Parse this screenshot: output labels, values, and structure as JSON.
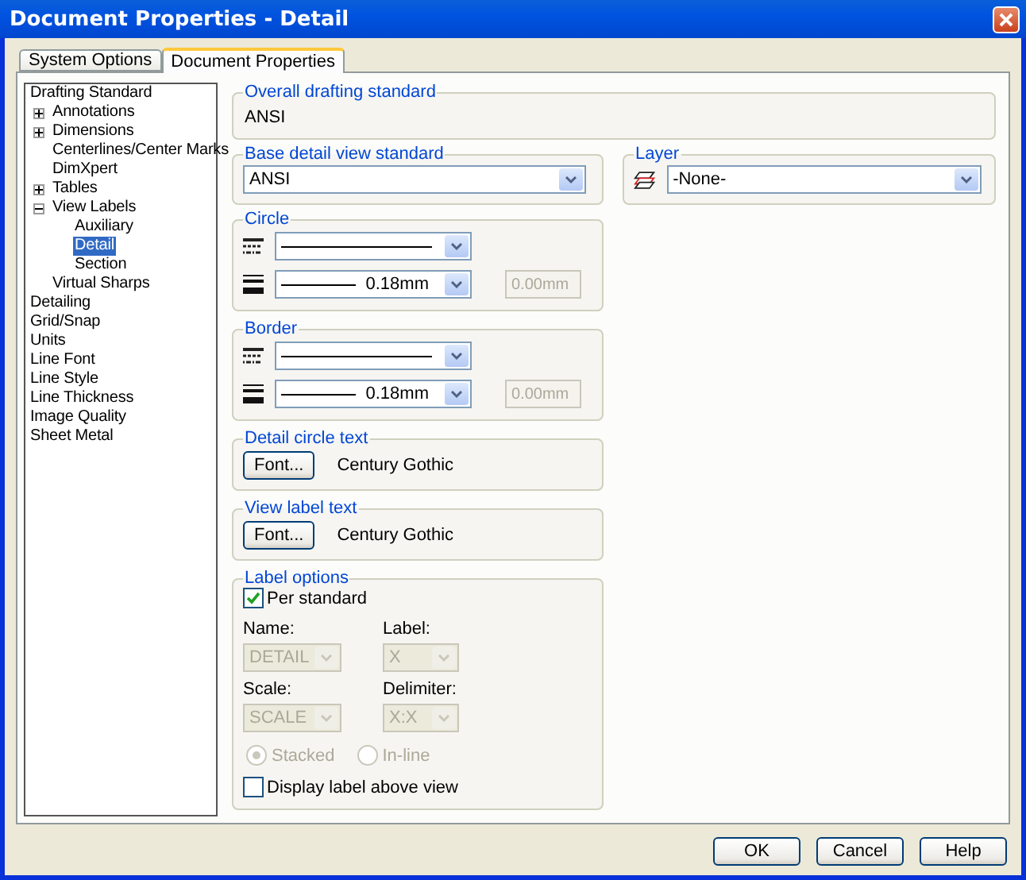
{
  "window": {
    "title": "Document Properties - Detail"
  },
  "tabs": [
    {
      "label": "System Options",
      "selected": false
    },
    {
      "label": "Document Properties",
      "selected": true
    }
  ],
  "tree": [
    {
      "label": "Drafting Standard",
      "selected": false,
      "children": [
        {
          "label": "Annotations",
          "selected": false,
          "expanded": false
        },
        {
          "label": "Dimensions",
          "selected": false,
          "expanded": false
        },
        {
          "label": "Centerlines/Center Marks",
          "selected": false
        },
        {
          "label": "DimXpert",
          "selected": false
        },
        {
          "label": "Tables",
          "selected": false,
          "expanded": false
        },
        {
          "label": "View Labels",
          "selected": false,
          "expanded": true,
          "children": [
            {
              "label": "Auxiliary",
              "selected": false
            },
            {
              "label": "Detail",
              "selected": true
            },
            {
              "label": "Section",
              "selected": false
            }
          ]
        },
        {
          "label": "Virtual Sharps",
          "selected": false
        }
      ]
    },
    {
      "label": "Detailing",
      "selected": false
    },
    {
      "label": "Grid/Snap",
      "selected": false
    },
    {
      "label": "Units",
      "selected": false
    },
    {
      "label": "Line Font",
      "selected": false
    },
    {
      "label": "Line Style",
      "selected": false
    },
    {
      "label": "Line Thickness",
      "selected": false
    },
    {
      "label": "Image Quality",
      "selected": false
    },
    {
      "label": "Sheet Metal",
      "selected": false
    }
  ],
  "overall_drafting_standard": {
    "title": "Overall drafting standard",
    "value": "ANSI"
  },
  "base_detail_view_standard": {
    "title": "Base detail view standard",
    "value": "ANSI"
  },
  "layer": {
    "title": "Layer",
    "value": "-None-"
  },
  "line_groups": [
    {
      "title": "Circle",
      "thickness": "0.18mm",
      "custom_thickness": "0.00mm",
      "custom_disabled": true
    },
    {
      "title": "Border",
      "thickness": "0.18mm",
      "custom_thickness": "0.00mm",
      "custom_disabled": true
    }
  ],
  "font_groups": [
    {
      "title": "Detail circle text",
      "button": "Font...",
      "font": "Century Gothic"
    },
    {
      "title": "View label text",
      "button": "Font...",
      "font": "Century Gothic"
    }
  ],
  "label_options": {
    "title": "Label options",
    "per_standard": {
      "label": "Per standard",
      "checked": true
    },
    "fields": [
      {
        "label": "Name:",
        "value": "DETAIL",
        "disabled": true
      },
      {
        "label": "Label:",
        "value": "X",
        "disabled": true
      },
      {
        "label": "Scale:",
        "value": "SCALE",
        "disabled": true
      },
      {
        "label": "Delimiter:",
        "value": "X:X",
        "disabled": true
      }
    ],
    "radios": [
      {
        "label": "Stacked",
        "selected": true,
        "disabled": true
      },
      {
        "label": "In-line",
        "selected": false,
        "disabled": true
      }
    ],
    "display_above": {
      "label": "Display label above view",
      "checked": false
    }
  },
  "buttons": [
    "OK",
    "Cancel",
    "Help"
  ]
}
